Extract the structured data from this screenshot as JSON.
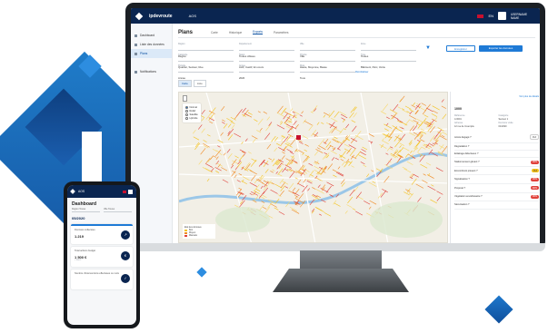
{
  "app": {
    "brand": "ipdevroute",
    "name": "AOS",
    "language": "EN",
    "user_name": "USERNAME NAME"
  },
  "sidebar": {
    "items": [
      {
        "label": "Dashboard",
        "active": false
      },
      {
        "label": "Liste des données",
        "active": false
      },
      {
        "label": "Plans",
        "active": true
      },
      {
        "label": "Notifications",
        "active": false
      }
    ]
  },
  "page": {
    "title": "Plans",
    "tabs": [
      "Carte",
      "Historique",
      "Exports",
      "Paramètres"
    ],
    "active_tab": 2
  },
  "filters": [
    {
      "label": "Région",
      "value": "Région"
    },
    {
      "label": "Département",
      "value": "Toutes ciblées"
    },
    {
      "label": "Ville",
      "value": "Ville"
    },
    {
      "label": "Zone",
      "value": "Toutes"
    },
    {
      "label": "Catégorie",
      "value": "Quartier, Secteur, Rue"
    },
    {
      "label": "Statut",
      "value": "Actif, Inactif, En cours"
    },
    {
      "label": "Priorité",
      "value": "Haute, Moyenne, Basse"
    },
    {
      "label": "Type",
      "value": "Bâtiment, Parc, Voirie"
    },
    {
      "label": "Période",
      "value": "Année"
    },
    {
      "label": "Année",
      "value": "2020"
    },
    {
      "label": "Mois",
      "value": "Tous"
    }
  ],
  "actions": {
    "filter_icon": "funnel-icon",
    "secondary": "Enregistrer",
    "primary": "Exporter les données",
    "reset": "Réinitialiser"
  },
  "view_toggle": [
    "Carte",
    "Liste"
  ],
  "map": {
    "layers": [
      "Normal",
      "Relief",
      "Satellite",
      "Hybride"
    ],
    "selected_layer": 0,
    "legend_title": "Etat des données",
    "legend": [
      {
        "label": "Bon",
        "color": "#f4c21c"
      },
      {
        "label": "Moyen",
        "color": "#f08a24"
      },
      {
        "label": "Mauvais",
        "color": "#e0413a"
      }
    ]
  },
  "detail": {
    "link": "Voir plus de détails",
    "id": "1000",
    "fields": [
      {
        "k": "Référence",
        "v": "A 0001"
      },
      {
        "k": "Catégorie",
        "v": "Secteur 1"
      },
      {
        "k": "Adresse",
        "v": "12 rue de l'exemple"
      },
      {
        "k": "Dernière visite",
        "v": "01/2020"
      }
    ],
    "questions": [
      {
        "q": "Accès dégagé ?",
        "a": "OUI",
        "style": "plain"
      },
      {
        "q": "Dégradation ?",
        "a": "",
        "style": "none"
      },
      {
        "q": "Eclairage défectueux ?",
        "a": "",
        "style": "none"
      },
      {
        "q": "Stationnement gênant ?",
        "a": "NON",
        "style": "red"
      },
      {
        "q": "Encombrant présent ?",
        "a": "OUI",
        "style": "yellow"
      },
      {
        "q": "Signalisation ?",
        "a": "NON",
        "style": "red"
      },
      {
        "q": "Propreté ?",
        "a": "NON",
        "style": "red"
      },
      {
        "q": "Végétation envahissante ?",
        "a": "NON",
        "style": "red"
      },
      {
        "q": "Sécurisation ?",
        "a": "",
        "style": "none"
      }
    ]
  },
  "phone": {
    "app_name": "AOS",
    "title": "Dashboard",
    "selectors": [
      "Région Toutes",
      "Ville Toutes"
    ],
    "date": "05/2020",
    "cards": [
      {
        "label": "Données collectées",
        "value": "1.219",
        "sub": "",
        "icon": "chart-icon"
      },
      {
        "label": "Total actions budget",
        "value": "1 500 €",
        "sub": "+ 250 €",
        "icon": "euro-icon"
      },
      {
        "label": "Nombre d'interventions effectuées ce mois",
        "value": "",
        "sub": "",
        "icon": "check-icon"
      }
    ]
  }
}
